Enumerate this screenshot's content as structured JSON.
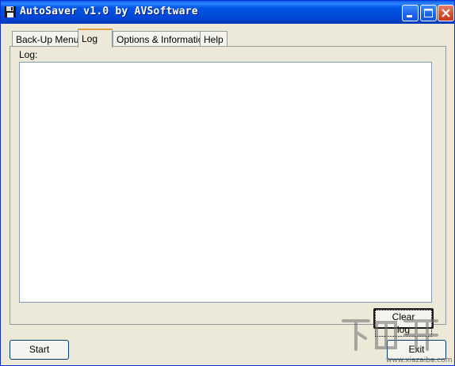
{
  "window": {
    "title": "AutoSaver v1.0 by AVSoftware",
    "icons": [
      "app-icon",
      "minimize-icon",
      "maximize-icon",
      "close-icon"
    ]
  },
  "tabs": [
    {
      "label": "Back-Up Menu",
      "active": false
    },
    {
      "label": "Log",
      "active": true
    },
    {
      "label": "Options & Information",
      "active": false
    },
    {
      "label": "Help",
      "active": false
    }
  ],
  "log_panel": {
    "label": "Log:",
    "content": "",
    "clear_button": "Clear log"
  },
  "footer": {
    "start_button": "Start",
    "exit_button": "Exit"
  },
  "watermark": {
    "text": "下载吧",
    "url": "www.xiazaiba.com"
  },
  "colors": {
    "titlebar": "#0054E3",
    "window_face": "#ECE9D8",
    "close_button": "#D5512F",
    "active_tab_accent": "#E6A23C"
  }
}
